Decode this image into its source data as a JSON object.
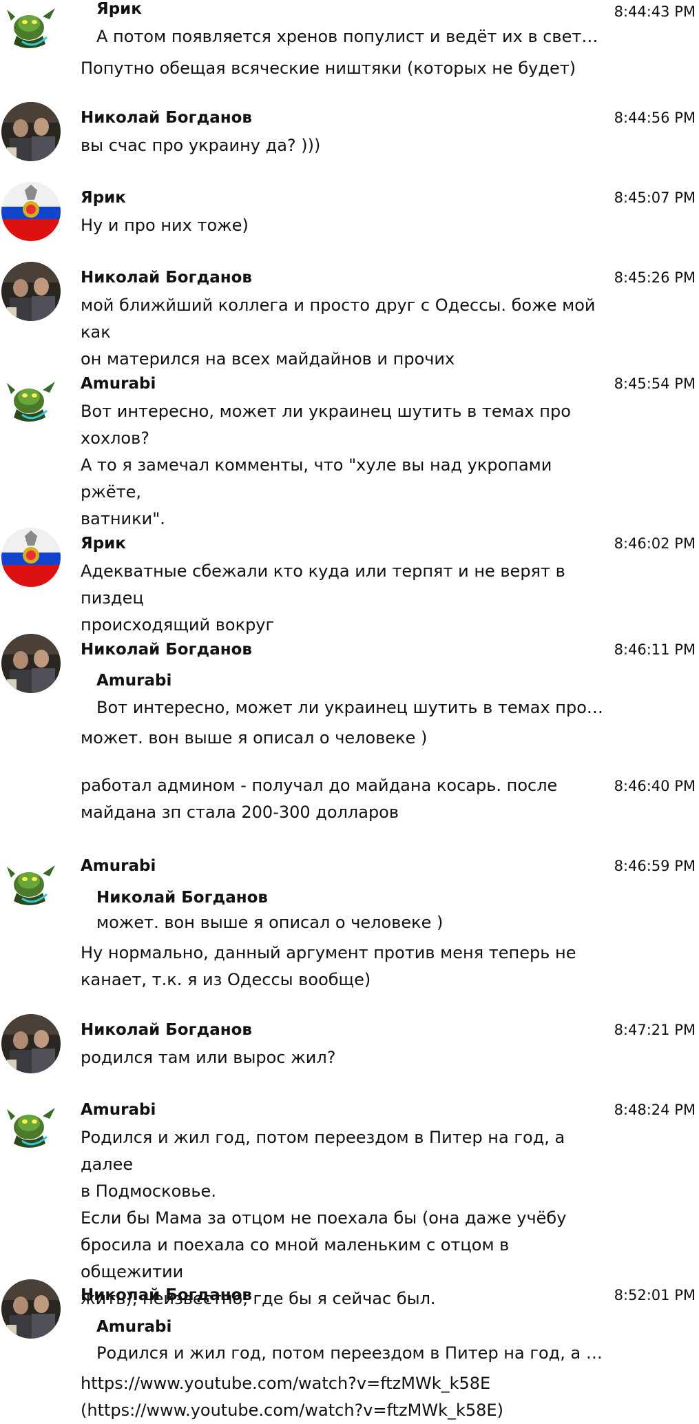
{
  "messages": [
    {
      "author": "Ярик",
      "time": "8:44:43 PM",
      "avatar": "goblin-avatar",
      "quote": "А потом появляется хренов популист и ведёт их в светлое …",
      "text": "Попутно обещая всяческие ништяки (которых не будет)"
    },
    {
      "author": "Николай Богданов",
      "time": "8:44:56 PM",
      "avatar": "photo-avatar",
      "text": "вы счас про украину да? )))"
    },
    {
      "author": "Ярик",
      "time": "8:45:07 PM",
      "avatar": "flag-avatar",
      "text": "Ну и про них тоже)"
    },
    {
      "author": "Николай Богданов",
      "time": "8:45:26 PM",
      "avatar": "photo-avatar",
      "text_lines": [
        "мой ближйший коллега и просто друг с Одессы. боже мой как",
        "он матерился на всех майдайнов и прочих"
      ]
    },
    {
      "author": "Amurabi",
      "time": "8:45:54 PM",
      "avatar": "goblin-avatar",
      "text_lines": [
        "Вот интересно, может ли украинец шутить в темах про",
        "хохлов?",
        "А то я замечал комменты, что \"хуле вы над укропами ржёте,",
        "ватники\"."
      ]
    },
    {
      "author": "Ярик",
      "time": "8:46:02 PM",
      "avatar": "flag-avatar",
      "text_lines": [
        "Адекватные сбежали кто куда или терпят и не верят в пиздец",
        "происходящий вокруг"
      ]
    },
    {
      "author": "Николай Богданов",
      "time": "8:46:11 PM",
      "avatar": "photo-avatar",
      "quote_author": "Amurabi",
      "quote": "Вот интересно, может ли украинец шутить в темах про хох…",
      "text": "может. вон выше я описал о человеке )"
    },
    {
      "time": "8:46:40 PM",
      "text_lines": [
        "работал админом - получал до майдана косарь. после",
        "майдана зп стала 200-300 долларов"
      ]
    },
    {
      "author": "Amurabi",
      "time": "8:46:59 PM",
      "avatar": "goblin-avatar",
      "quote_author": "Николай Богданов",
      "quote": "может. вон выше я описал о человеке )",
      "text_lines": [
        "Ну нормально, данный аргумент против меня теперь не",
        "канает, т.к. я из Одессы вообще)"
      ]
    },
    {
      "author": "Николай Богданов",
      "time": "8:47:21 PM",
      "avatar": "photo-avatar",
      "text": "родился там или вырос жил?"
    },
    {
      "author": "Amurabi",
      "time": "8:48:24 PM",
      "avatar": "goblin-avatar",
      "text_lines": [
        "Родился и жил год, потом переездом в Питер на год, а далее",
        "в Подмосковье.",
        "Если бы Мама за отцом не поехала бы (она даже учёбу",
        "бросила и поехала со мной маленьким с отцом в общежитии",
        "жить), неизвестно, где бы я сейчас был."
      ]
    },
    {
      "author": "Николай Богданов",
      "time": "8:52:01 PM",
      "avatar": "photo-avatar",
      "quote_author": "Amurabi",
      "quote": "Родился и жил год, потом переездом в Питер на год, а дал…",
      "text_lines": [
        "https://www.youtube.com/watch?v=ftzMWk_k58E",
        "(https://www.youtube.com/watch?v=ftzMWk_k58E)"
      ]
    }
  ]
}
